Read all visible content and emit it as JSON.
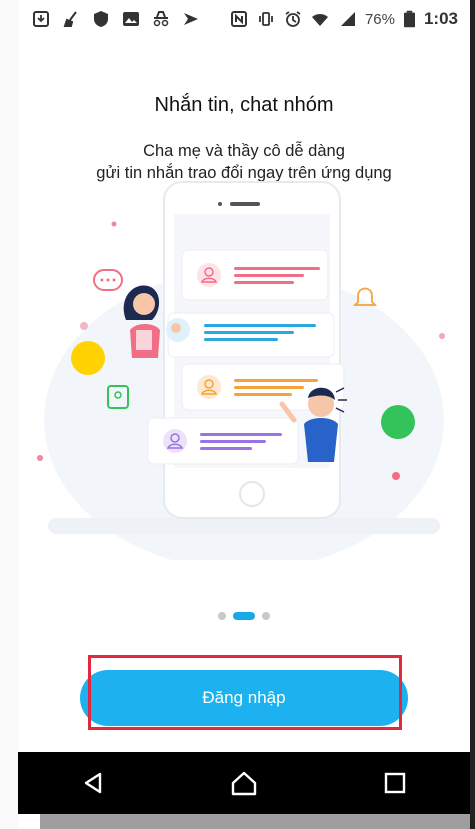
{
  "status_bar": {
    "battery_percent": "76%",
    "time": "1:03",
    "left_icons": [
      "download-icon",
      "broom-icon",
      "shield-icon",
      "image-icon",
      "incognito-icon",
      "navigation-icon"
    ],
    "right_icons": [
      "nfc-icon",
      "vibrate-icon",
      "alarm-icon",
      "wifi-icon",
      "signal-icon",
      "battery-icon"
    ]
  },
  "onboarding": {
    "title": "Nhắn tin, chat nhóm",
    "subtitle_line1": "Cha mẹ và thầy cô dễ dàng",
    "subtitle_line2": "gửi tin nhắn trao đổi ngay trên ứng dụng",
    "page_count": 3,
    "active_page": 2
  },
  "actions": {
    "login_label": "Đăng nhập"
  },
  "navigation": {
    "icons": [
      "back-icon",
      "home-icon",
      "recents-icon"
    ]
  },
  "colors": {
    "accent": "#1db2ef",
    "highlight": "#e0283e",
    "card_pink": "#f06e86",
    "card_blue": "#2aa9e0",
    "card_orange": "#f5a23a",
    "card_purple": "#9b73e0"
  }
}
